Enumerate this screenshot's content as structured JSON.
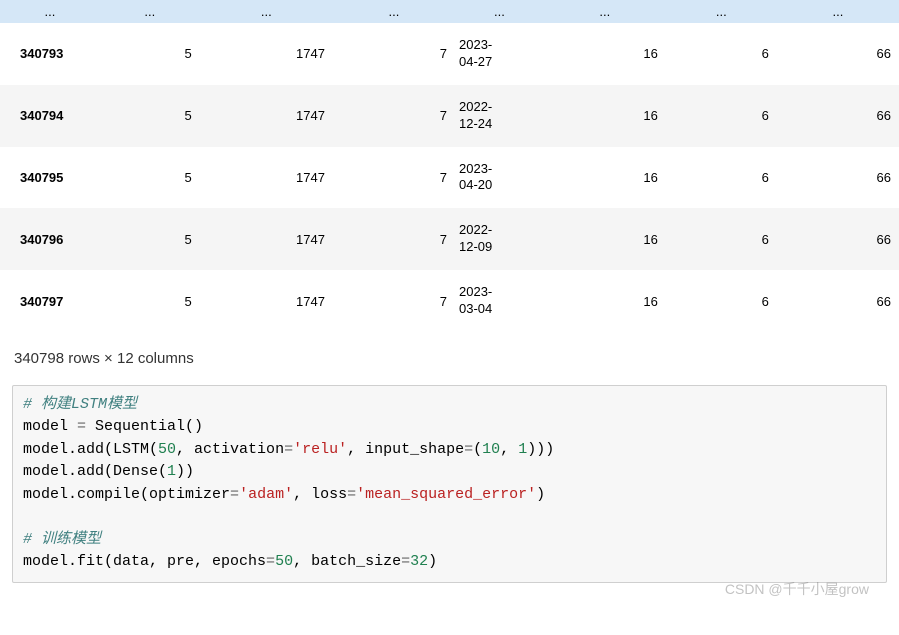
{
  "table": {
    "ellipsis": "...",
    "rows": [
      {
        "idx": "340793",
        "c1": "5",
        "c2": "1747",
        "c3": "7",
        "date_a": "2023-",
        "date_b": "04-27",
        "c5": "16",
        "c6": "6",
        "c7": "66"
      },
      {
        "idx": "340794",
        "c1": "5",
        "c2": "1747",
        "c3": "7",
        "date_a": "2022-",
        "date_b": "12-24",
        "c5": "16",
        "c6": "6",
        "c7": "66"
      },
      {
        "idx": "340795",
        "c1": "5",
        "c2": "1747",
        "c3": "7",
        "date_a": "2023-",
        "date_b": "04-20",
        "c5": "16",
        "c6": "6",
        "c7": "66"
      },
      {
        "idx": "340796",
        "c1": "5",
        "c2": "1747",
        "c3": "7",
        "date_a": "2022-",
        "date_b": "12-09",
        "c5": "16",
        "c6": "6",
        "c7": "66"
      },
      {
        "idx": "340797",
        "c1": "5",
        "c2": "1747",
        "c3": "7",
        "date_a": "2023-",
        "date_b": "03-04",
        "c5": "16",
        "c6": "6",
        "c7": "66"
      }
    ]
  },
  "summary": "340798 rows × 12 columns",
  "code": {
    "comment1": "# 构建LSTM模型",
    "l2_a": "model ",
    "l2_b": "=",
    "l2_c": " Sequential()",
    "l3_a": "model.add(LSTM(",
    "l3_b": "50",
    "l3_c": ", activation",
    "l3_d": "=",
    "l3_e": "'relu'",
    "l3_f": ", input_shape",
    "l3_g": "=",
    "l3_h": "(",
    "l3_i": "10",
    "l3_j": ", ",
    "l3_k": "1",
    "l3_l": ")))",
    "l4_a": "model.add(Dense(",
    "l4_b": "1",
    "l4_c": "))",
    "l5_a": "model.compile(optimizer",
    "l5_b": "=",
    "l5_c": "'adam'",
    "l5_d": ", loss",
    "l5_e": "=",
    "l5_f": "'mean_squared_error'",
    "l5_g": ")",
    "comment2": "# 训练模型",
    "l7_a": "model.fit(data, pre, epochs",
    "l7_b": "=",
    "l7_c": "50",
    "l7_d": ", batch_size",
    "l7_e": "=",
    "l7_f": "32",
    "l7_g": ")"
  },
  "watermark": "CSDN @千千小屋grow"
}
